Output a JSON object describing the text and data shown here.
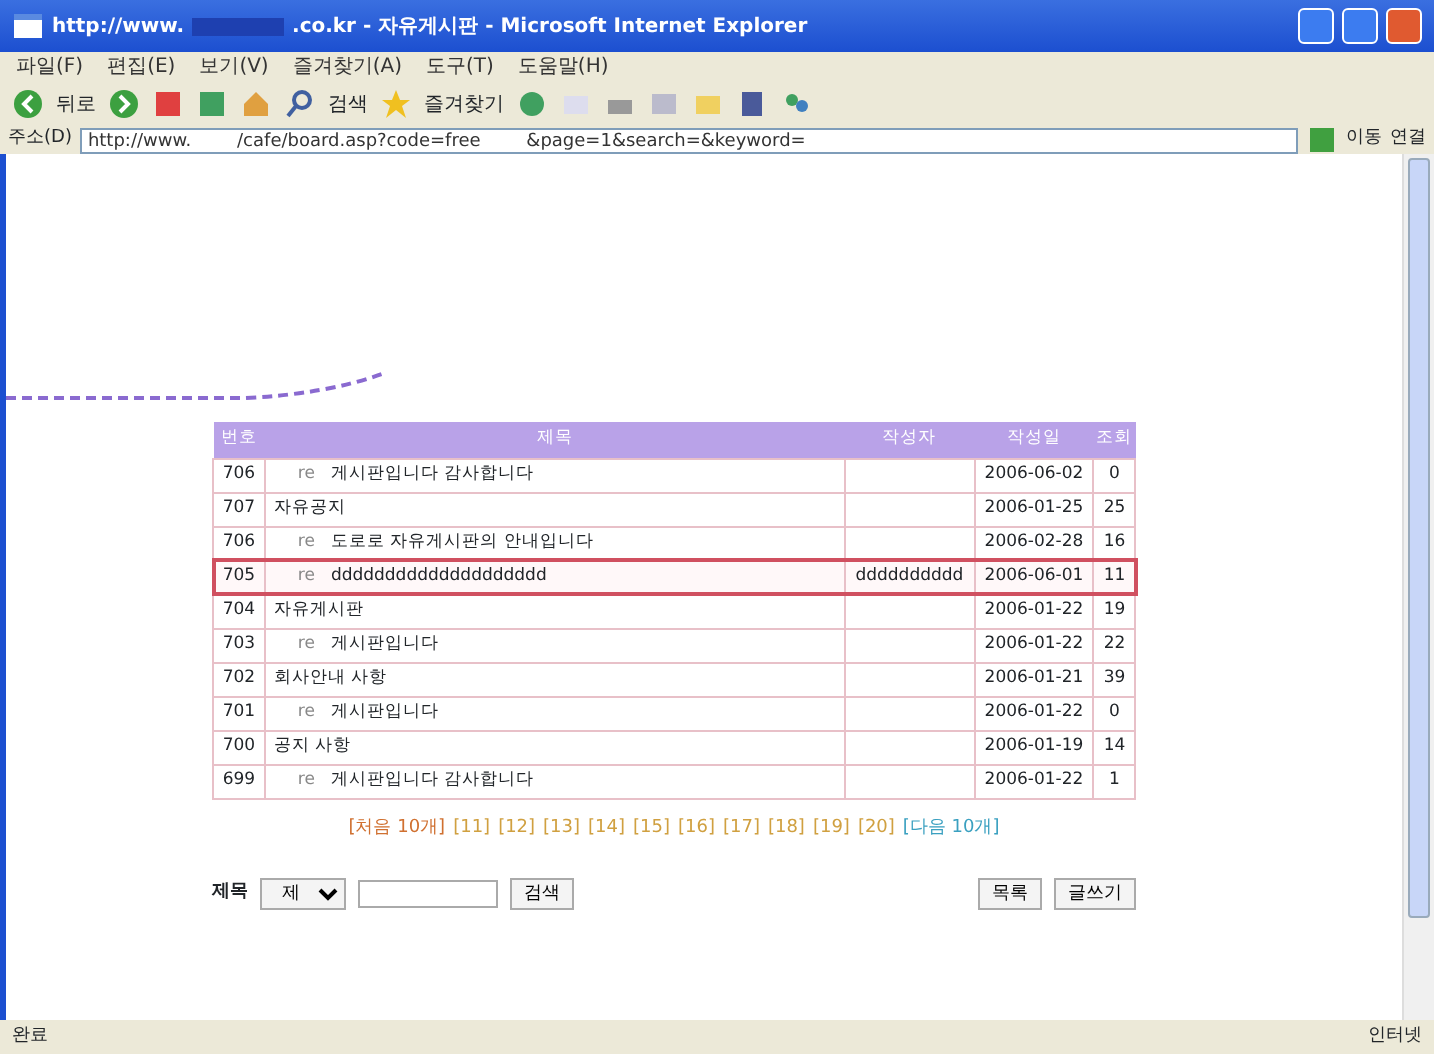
{
  "window": {
    "title_start": "http://www.",
    "title_end": ".co.kr - 자유게시판 - Microsoft Internet Explorer"
  },
  "menu": [
    "파일(F)",
    "편집(E)",
    "보기(V)",
    "즐겨찾기(A)",
    "도구(T)",
    "도움말(H)"
  ],
  "toolbar": {
    "back": "뒤로",
    "search": "검색",
    "favorites": "즐겨찾기"
  },
  "address": {
    "label": "주소(D)",
    "url": "http://www.        /cafe/board.asp?code=free        &page=1&search=&keyword=",
    "go": "이동",
    "links": "연결"
  },
  "table": {
    "columns": [
      "번호",
      "제목",
      "작성자",
      "작성일",
      "조회"
    ],
    "rows": [
      {
        "number": "706",
        "reply_mark": "re",
        "title": "게시판입니다 감사합니다",
        "author": "",
        "date": "2006-06-02",
        "views": "0",
        "selected": false
      },
      {
        "number": "707",
        "title": "자유공지",
        "author": "",
        "date": "2006-01-25",
        "views": "25",
        "selected": false
      },
      {
        "number": "706",
        "reply_mark": "re",
        "title": "도로로 자유게시판의 안내입니다",
        "author": "",
        "date": "2006-02-28",
        "views": "16",
        "selected": false
      },
      {
        "number": "705",
        "reply_mark": "re",
        "title": "dddddddddddddddddddd",
        "author": "dddddddddd",
        "date": "2006-06-01",
        "views": "11",
        "selected": true
      },
      {
        "number": "704",
        "title": "자유게시판",
        "author": "",
        "date": "2006-01-22",
        "views": "19",
        "selected": false
      },
      {
        "number": "703",
        "reply_mark": "re",
        "title": "게시판입니다",
        "author": "",
        "date": "2006-01-22",
        "views": "22",
        "selected": false
      },
      {
        "number": "702",
        "title": "회사안내 사항",
        "author": "",
        "date": "2006-01-21",
        "views": "39",
        "selected": false
      },
      {
        "number": "701",
        "reply_mark": "re",
        "title": "게시판입니다",
        "author": "",
        "date": "2006-01-22",
        "views": "0",
        "selected": false
      },
      {
        "number": "700",
        "title": "공지 사항",
        "author": "",
        "date": "2006-01-19",
        "views": "14",
        "selected": false
      },
      {
        "number": "699",
        "reply_mark": "re",
        "title": "게시판입니다 감사합니다",
        "author": "",
        "date": "2006-01-22",
        "views": "1",
        "selected": false
      }
    ]
  },
  "pagination": [
    {
      "label": "[처음 10개]",
      "kind": "nav"
    },
    {
      "label": "[11]",
      "kind": "page"
    },
    {
      "label": "[12]",
      "kind": "page"
    },
    {
      "label": "[13]",
      "kind": "page"
    },
    {
      "label": "[14]",
      "kind": "page"
    },
    {
      "label": "[15]",
      "kind": "page"
    },
    {
      "label": "[16]",
      "kind": "page"
    },
    {
      "label": "[17]",
      "kind": "page"
    },
    {
      "label": "[18]",
      "kind": "page"
    },
    {
      "label": "[19]",
      "kind": "page"
    },
    {
      "label": "[20]",
      "kind": "page"
    },
    {
      "label": "[다음 10개]",
      "kind": "next"
    }
  ],
  "search": {
    "label": "제목",
    "select": "제",
    "button": "검색"
  },
  "buttons": [
    "목록",
    "글쓰기"
  ],
  "status_bar": {
    "left": "완료",
    "right": "인터넷"
  }
}
